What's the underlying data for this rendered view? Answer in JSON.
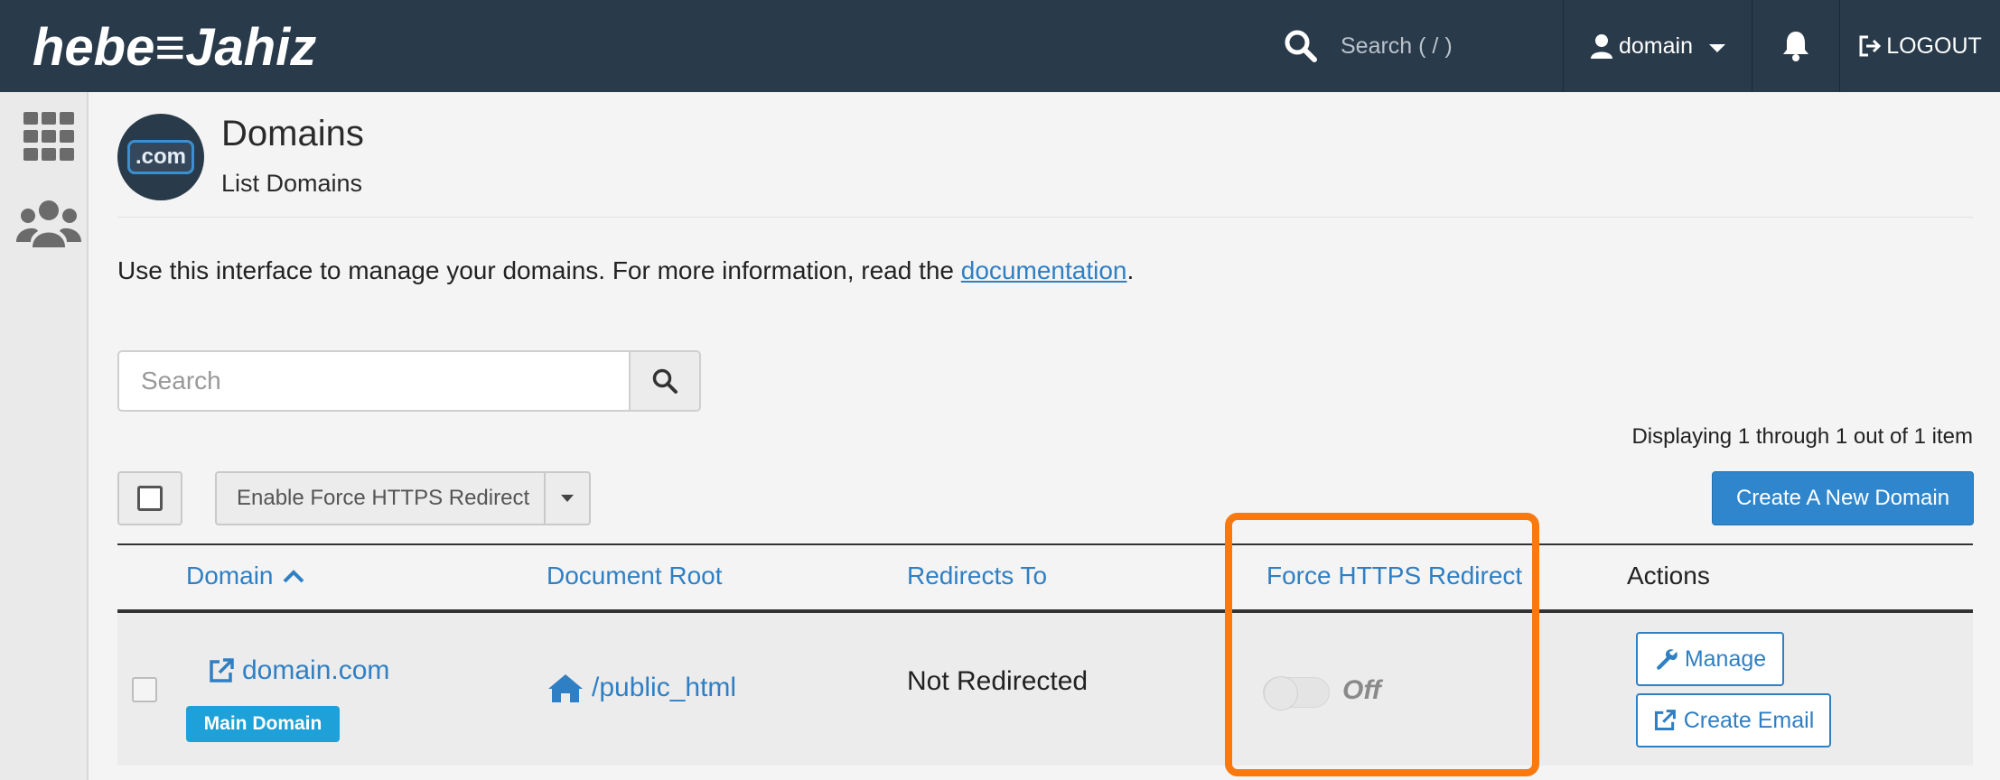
{
  "topbar": {
    "logo_text": "hebe≡Jahiz",
    "search_placeholder": "Search ( / )",
    "user_label": "domain",
    "logout_label": "LOGOUT"
  },
  "header": {
    "icon_text": ".com",
    "title": "Domains",
    "subtitle": "List Domains"
  },
  "intro": {
    "text": "Use this interface to manage your domains. For more information, read the ",
    "link_label": "documentation",
    "trailing": "."
  },
  "search": {
    "placeholder": "Search"
  },
  "pagination": {
    "summary": "Displaying 1 through 1 out of 1 item"
  },
  "bulk": {
    "action_label": "Enable Force HTTPS Redirect"
  },
  "create_button_label": "Create A New Domain",
  "table": {
    "columns": {
      "domain": "Domain",
      "document_root": "Document Root",
      "redirects_to": "Redirects To",
      "force_https": "Force HTTPS Redirect",
      "actions": "Actions"
    },
    "sort": {
      "column": "domain",
      "direction": "ascending"
    },
    "rows": [
      {
        "domain": "domain.com",
        "badge": "Main Domain",
        "document_root": "/public_html",
        "redirects_to": "Not Redirected",
        "force_https": {
          "enabled": false,
          "label": "Off"
        },
        "actions": {
          "manage": "Manage",
          "create_email": "Create Email"
        }
      }
    ]
  },
  "colors": {
    "topbar": "#293a4a",
    "link": "#2f7fc4",
    "primary_button": "#2f86cc",
    "badge": "#1ea0d8",
    "highlight": "#f7790f"
  }
}
